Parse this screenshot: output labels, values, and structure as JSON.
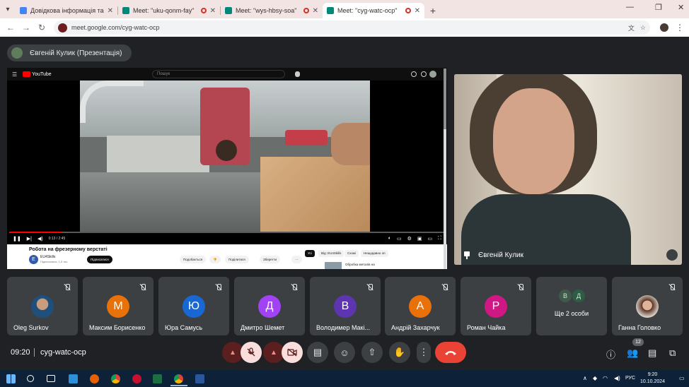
{
  "browser": {
    "tabs": [
      {
        "title": "Довідкова інформація та ві",
        "favicon_color": "#4285f4",
        "recording": false,
        "active": false
      },
      {
        "title": "Meet: \"uku-qonm-fay\"",
        "favicon_color": "#00897b",
        "recording": true,
        "active": false
      },
      {
        "title": "Meet: \"wys-hbsy-soa\"",
        "favicon_color": "#00897b",
        "recording": true,
        "active": false
      },
      {
        "title": "Meet: \"cyg-watc-ocp\"",
        "favicon_color": "#00897b",
        "recording": true,
        "active": true
      }
    ],
    "url": "meet.google.com/cyg-watc-ocp"
  },
  "meet": {
    "presenter_chip": "Євгеній Кулик (Презентація)",
    "speaker_name": "Євгеній Кулик",
    "clock": "09:20",
    "meeting_code": "cyg-watc-ocp",
    "people_count": "12",
    "participants": [
      {
        "name": "Oleg Surkov",
        "initial": "",
        "color": "#2d5c8f",
        "has_photo": true
      },
      {
        "name": "Максим Борисенко",
        "initial": "М",
        "color": "#e8710a"
      },
      {
        "name": "Юра Самусь",
        "initial": "Ю",
        "color": "#1967d2"
      },
      {
        "name": "Дмитро Шемет",
        "initial": "Д",
        "color": "#a142f4"
      },
      {
        "name": "Володимер Макі...",
        "initial": "В",
        "color": "#5e35b1"
      },
      {
        "name": "Андрій Захарчук",
        "initial": "А",
        "color": "#e8710a"
      },
      {
        "name": "Роман Чайка",
        "initial": "Р",
        "color": "#d01884"
      }
    ],
    "more_tile": {
      "label": "Ще 2 особи",
      "initials": [
        "В",
        "Д"
      ]
    },
    "last_participant": {
      "name": "Ганна Головко"
    }
  },
  "youtube": {
    "logo": "YouTube",
    "search_placeholder": "Пошук",
    "video_title": "Робота на фрезерному верстаті",
    "channel": "EU4Skills",
    "channel_subs": "Підписалися: 1,5 тис.",
    "subscribe": "Підписатися",
    "like": "Подобається",
    "share": "Поділитися",
    "save": "Зберегти",
    "time": "0:13 / 2:45",
    "progress": 0.12,
    "chips": [
      "Усі",
      "Від: EU4Skills",
      "Схожі",
      "Нещодавно оп"
    ],
    "related_title": "Обробка металів на"
  },
  "taskbar": {
    "lang": "РУС",
    "time": "9:20",
    "date": "10.10.2024"
  },
  "colors": {
    "meet_bg": "#202124",
    "tile_bg": "#3c4043",
    "end_call": "#ea4335",
    "mic_off_bg": "#f9dedc",
    "tab_strip": "#f3e4e4"
  }
}
